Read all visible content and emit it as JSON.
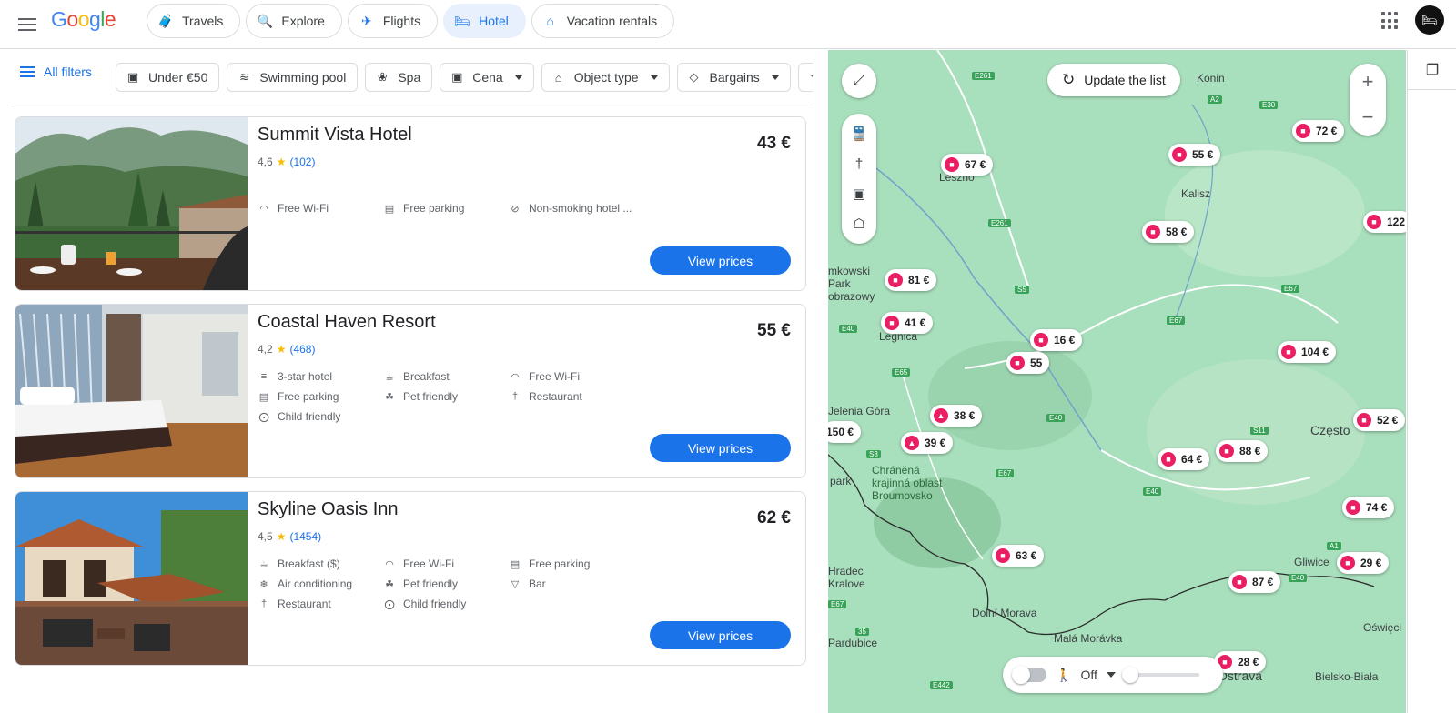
{
  "header": {
    "logo": "Google",
    "nav": [
      {
        "label": "Travels",
        "icon": "suitcase-icon",
        "active": false
      },
      {
        "label": "Explore",
        "icon": "explore-icon",
        "active": false
      },
      {
        "label": "Flights",
        "icon": "plane-icon",
        "active": false
      },
      {
        "label": "Hotel",
        "icon": "bed-icon",
        "active": true
      },
      {
        "label": "Vacation rentals",
        "icon": "house-icon",
        "active": false
      }
    ]
  },
  "filters": {
    "all_filters": "All filters",
    "chips": [
      {
        "label": "Under €50",
        "icon": "price-icon",
        "dropdown": false
      },
      {
        "label": "Swimming pool",
        "icon": "pool-icon",
        "dropdown": false
      },
      {
        "label": "Spa",
        "icon": "spa-icon",
        "dropdown": false
      },
      {
        "label": "Cena",
        "icon": "price-icon",
        "dropdown": true
      },
      {
        "label": "Object type",
        "icon": "building-icon",
        "dropdown": true
      },
      {
        "label": "Bargains",
        "icon": "tag-icon",
        "dropdown": true
      }
    ]
  },
  "hotels": [
    {
      "name": "Summit Vista Hotel",
      "price": "43 €",
      "rating": "4,6",
      "reviews": "(102)",
      "amenities": [
        {
          "label": "Free Wi-Fi",
          "icon": "wifi-icon"
        },
        {
          "label": "Free parking",
          "icon": "parking-icon"
        },
        {
          "label": "Non-smoking hotel ...",
          "icon": "no-smoking-icon"
        }
      ],
      "button": "View prices"
    },
    {
      "name": "Coastal Haven Resort",
      "price": "55 €",
      "rating": "4,2",
      "reviews": "(468)",
      "amenities": [
        {
          "label": "3-star hotel",
          "icon": "bed-icon"
        },
        {
          "label": "Breakfast",
          "icon": "coffee-icon"
        },
        {
          "label": "Free Wi-Fi",
          "icon": "wifi-icon"
        },
        {
          "label": "Free parking",
          "icon": "parking-icon"
        },
        {
          "label": "Pet friendly",
          "icon": "paw-icon"
        },
        {
          "label": "Restaurant",
          "icon": "restaurant-icon"
        },
        {
          "label": "Child friendly",
          "icon": "stroller-icon"
        }
      ],
      "button": "View prices"
    },
    {
      "name": "Skyline Oasis Inn",
      "price": "62 €",
      "rating": "4,5",
      "reviews": "(1454)",
      "amenities": [
        {
          "label": "Breakfast ($)",
          "icon": "coffee-icon"
        },
        {
          "label": "Free Wi-Fi",
          "icon": "wifi-icon"
        },
        {
          "label": "Free parking",
          "icon": "parking-icon"
        },
        {
          "label": "Air conditioning",
          "icon": "snowflake-icon"
        },
        {
          "label": "Pet friendly",
          "icon": "paw-icon"
        },
        {
          "label": "Bar",
          "icon": "cocktail-icon"
        },
        {
          "label": "Restaurant",
          "icon": "restaurant-icon"
        },
        {
          "label": "Child friendly",
          "icon": "stroller-icon"
        }
      ],
      "button": "View prices"
    }
  ],
  "map": {
    "update_button": "Update the list",
    "bottom_toggle_label": "Off",
    "pins": [
      "67 €",
      "55 €",
      "72 €",
      "58 €",
      "122",
      "81 €",
      "41 €",
      "16 €",
      "55",
      "104 €",
      "38 €",
      "39 €",
      "150 €",
      "64 €",
      "88 €",
      "52 €",
      "74 €",
      "63 €",
      "87 €",
      "29 €",
      "28 €"
    ],
    "places": [
      "Konin",
      "Kalisz",
      "Leszno",
      "Legnica",
      "Jelenia Góra",
      "Hradec Kralove",
      "Dolní Morava",
      "Malá Morávka",
      "Gliwice",
      "Bielsko-Biała",
      "Oświęci",
      "Często",
      "Chráněná krajinná oblast Broumovsko",
      "Pardubice",
      "park",
      "mkowski Park obrazowy",
      "Ostrava"
    ],
    "roads": [
      "E261",
      "A2",
      "E30",
      "E261",
      "S5",
      "E67",
      "E67",
      "E40",
      "E65",
      "E40",
      "S3",
      "S11",
      "E67",
      "E40",
      "E67",
      "A1",
      "E40",
      "E442",
      "35"
    ]
  }
}
